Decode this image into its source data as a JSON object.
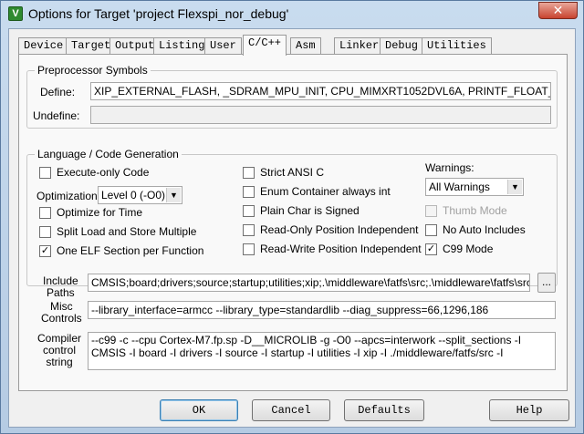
{
  "window": {
    "title": "Options for Target 'project Flexspi_nor_debug'",
    "close_glyph": "✕",
    "icon_letter": "V"
  },
  "tabs": [
    "Device",
    "Target",
    "Output",
    "Listing",
    "User",
    "C/C++",
    "Asm",
    "Linker",
    "Debug",
    "Utilities"
  ],
  "active_tab": "C/C++",
  "preprocessor": {
    "group_label": "Preprocessor Symbols",
    "define_label": "Define:",
    "define_value": "XIP_EXTERNAL_FLASH, _SDRAM_MPU_INIT, CPU_MIMXRT1052DVL6A, PRINTF_FLOAT_ENABLE",
    "undefine_label": "Undefine:",
    "undefine_value": ""
  },
  "language": {
    "group_label": "Language / Code Generation",
    "execute_only": {
      "label": "Execute-only Code",
      "checked": false
    },
    "optimization_label": "Optimization:",
    "optimization_value": "Level 0 (-O0)",
    "optimize_time": {
      "label": "Optimize for Time",
      "checked": false
    },
    "split_load": {
      "label": "Split Load and Store Multiple",
      "checked": false
    },
    "one_elf": {
      "label": "One ELF Section per Function",
      "checked": true
    },
    "strict_ansi": {
      "label": "Strict ANSI C",
      "checked": false
    },
    "enum_container": {
      "label": "Enum Container always int",
      "checked": false
    },
    "plain_char": {
      "label": "Plain Char is Signed",
      "checked": false
    },
    "ro_pi": {
      "label": "Read-Only Position Independent",
      "checked": false
    },
    "rw_pi": {
      "label": "Read-Write Position Independent",
      "checked": false
    },
    "warnings_label": "Warnings:",
    "warnings_value": "All Warnings",
    "thumb_mode": {
      "label": "Thumb Mode",
      "checked": false,
      "disabled": true
    },
    "no_auto_includes": {
      "label": "No Auto Includes",
      "checked": false
    },
    "c99_mode": {
      "label": "C99 Mode",
      "checked": true
    }
  },
  "include_paths": {
    "label_line1": "Include",
    "label_line2": "Paths",
    "value": "CMSIS;board;drivers;source;startup;utilities;xip;.\\middleware\\fatfs\\src;.\\middleware\\fatfs\\src\\fsl_sd_d",
    "browse_label": "..."
  },
  "misc_controls": {
    "label_line1": "Misc",
    "label_line2": "Controls",
    "value": "--library_interface=armcc --library_type=standardlib --diag_suppress=66,1296,186"
  },
  "compiler_string": {
    "label_line1": "Compiler",
    "label_line2": "control",
    "label_line3": "string",
    "value": "--c99 -c --cpu Cortex-M7.fp.sp -D__MICROLIB -g -O0 --apcs=interwork --split_sections -I CMSIS -I board -I drivers -I source -I startup -I utilities -I xip -I ./middleware/fatfs/src -I"
  },
  "buttons": {
    "ok": "OK",
    "cancel": "Cancel",
    "defaults": "Defaults",
    "help": "Help"
  },
  "check_glyph": "✓",
  "dropdown_glyph": "▼"
}
